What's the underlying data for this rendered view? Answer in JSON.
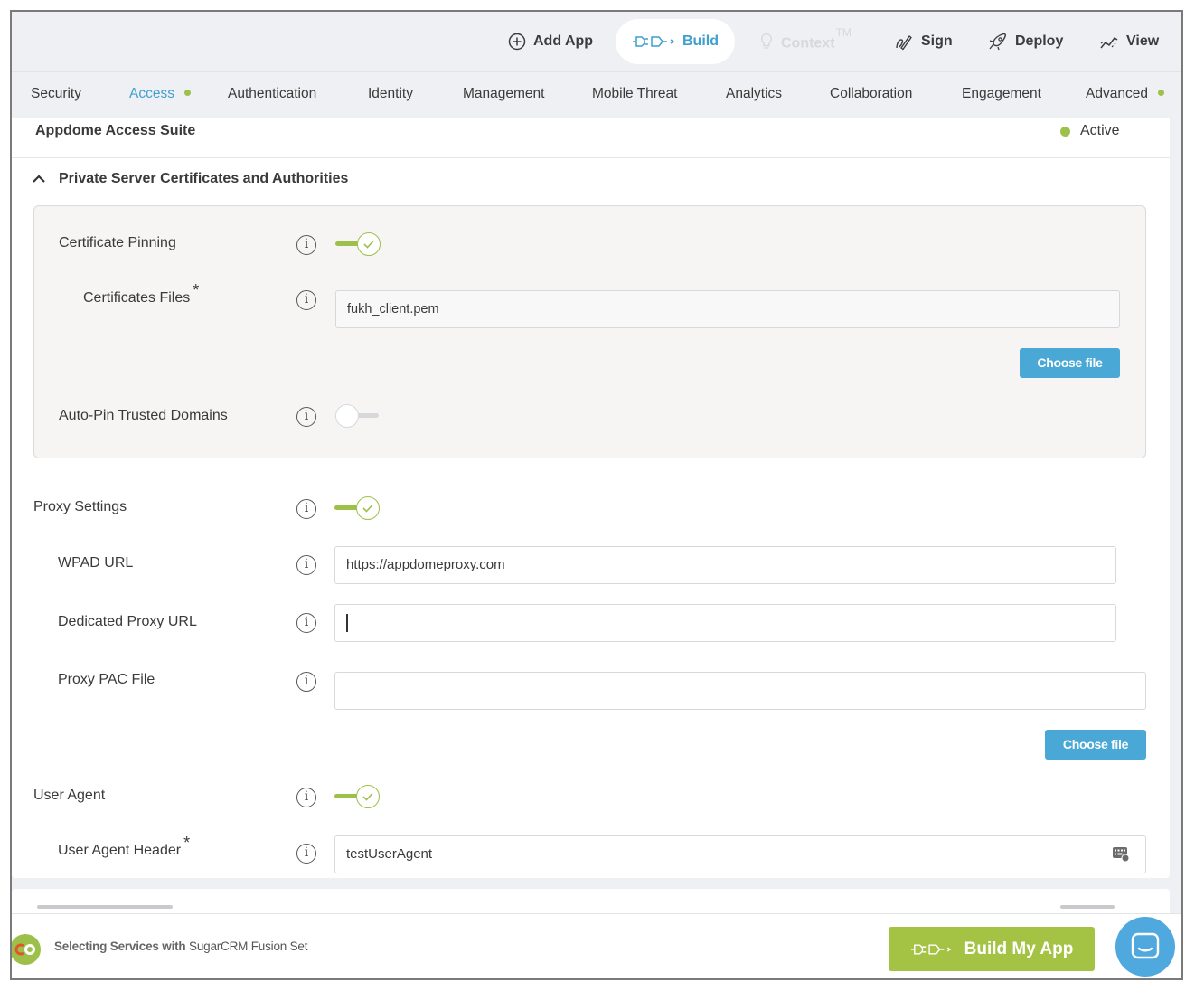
{
  "topnav": {
    "add_app": "Add App",
    "build": "Build",
    "context": "Context",
    "context_tm": "TM",
    "sign": "Sign",
    "deploy": "Deploy",
    "view": "View"
  },
  "tabs": [
    {
      "label": "Security"
    },
    {
      "label": "Access",
      "active": true,
      "dot": true
    },
    {
      "label": "Authentication"
    },
    {
      "label": "Identity"
    },
    {
      "label": "Management"
    },
    {
      "label": "Mobile Threat"
    },
    {
      "label": "Analytics"
    },
    {
      "label": "Collaboration"
    },
    {
      "label": "Engagement"
    },
    {
      "label": "Advanced",
      "dot": true
    }
  ],
  "suite": {
    "title": "Appdome Access Suite",
    "status": "Active"
  },
  "section": {
    "title": "Private Server Certificates and Authorities"
  },
  "fields": {
    "cert_pinning": {
      "label": "Certificate Pinning",
      "enabled": true
    },
    "cert_files": {
      "label": "Certificates Files",
      "required": "*",
      "value": "fukh_client.pem",
      "button": "Choose file"
    },
    "auto_pin": {
      "label": "Auto-Pin Trusted Domains",
      "enabled": false
    },
    "proxy_settings": {
      "label": "Proxy Settings",
      "enabled": true
    },
    "wpad_url": {
      "label": "WPAD URL",
      "value": "https://appdomeproxy.com"
    },
    "dedicated_proxy": {
      "label": "Dedicated Proxy URL",
      "value": ""
    },
    "proxy_pac": {
      "label": "Proxy PAC File",
      "value": "",
      "button": "Choose file"
    },
    "user_agent": {
      "label": "User Agent",
      "enabled": true
    },
    "user_agent_header": {
      "label": "User Agent Header",
      "required": "*",
      "value": "testUserAgent"
    }
  },
  "info_symbol": "i",
  "bottom": {
    "fusion_prefix": "Selecting Services with",
    "fusion_set": "SugarCRM Fusion Set",
    "build_button": "Build My App"
  },
  "colors": {
    "accent_blue": "#3f9fd0",
    "button_blue": "#4aa8d6",
    "active_green": "#9cc04a",
    "build_green": "#a4c244"
  },
  "icons": {
    "add_app": "plus-circle-icon",
    "build": "plug-icon",
    "context": "lightbulb-icon",
    "sign": "pen-signature-icon",
    "deploy": "rocket-icon",
    "view": "chart-line-icon",
    "collapse": "chevron-up-icon",
    "info": "info-icon",
    "chat": "chat-bubble-icon",
    "user_agent_field": "keyboard-icon"
  }
}
